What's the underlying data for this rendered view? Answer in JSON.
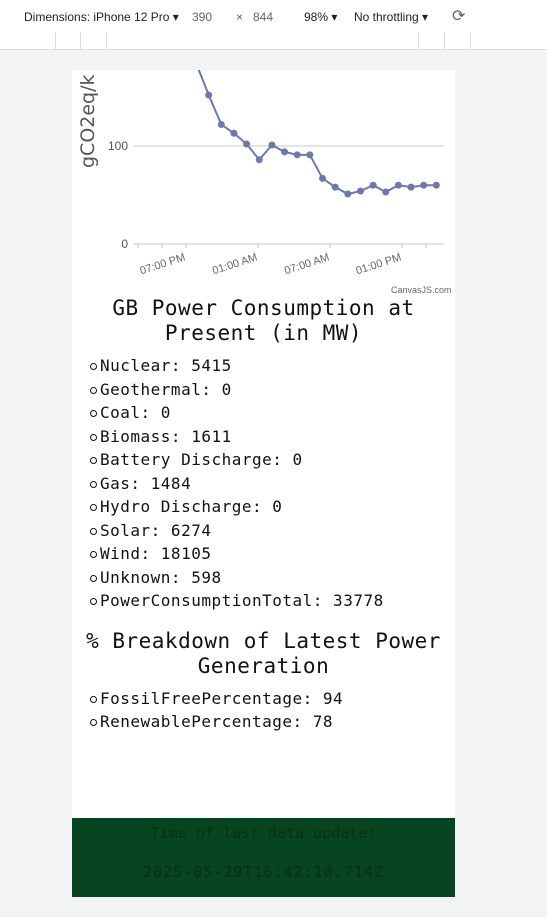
{
  "devtools": {
    "dimensions_label": "Dimensions: iPhone 12 Pro",
    "width": "390",
    "times": "×",
    "height": "844",
    "zoom": "98%",
    "throttling": "No throttling",
    "rotate_icon": "rotate-icon"
  },
  "chart_data": {
    "type": "line",
    "ylabel": "gCO2eq/k",
    "yticks": [
      0,
      100
    ],
    "ylim": [
      0,
      160
    ],
    "xtick_labels": [
      "07:00 PM",
      "01:00 AM",
      "07:00 AM",
      "01:00 PM"
    ],
    "series": [
      {
        "color": "#6d78ad",
        "values": [
          185,
          152,
          122,
          113,
          102,
          86,
          101,
          94,
          91,
          91,
          67,
          58,
          51,
          54,
          60,
          53,
          60,
          58,
          60,
          60
        ]
      }
    ],
    "credit": "CanvasJS.com"
  },
  "consumption": {
    "title": "GB Power Consumption at Present (in MW)",
    "items": [
      "Nuclear: 5415",
      "Geothermal: 0",
      "Coal: 0",
      "Biomass: 1611",
      "Battery Discharge: 0",
      "Gas: 1484",
      "Hydro Discharge: 0",
      "Solar: 6274",
      "Wind: 18105",
      "Unknown: 598",
      "PowerConsumptionTotal: 33778"
    ]
  },
  "breakdown": {
    "title": "% Breakdown of Latest Power Generation",
    "items": [
      "FossilFreePercentage: 94",
      "RenewablePercentage: 78"
    ]
  },
  "footer": {
    "label": "Time of last data update:",
    "timestamp": "2025-05-29T16:42:10.714Z"
  }
}
